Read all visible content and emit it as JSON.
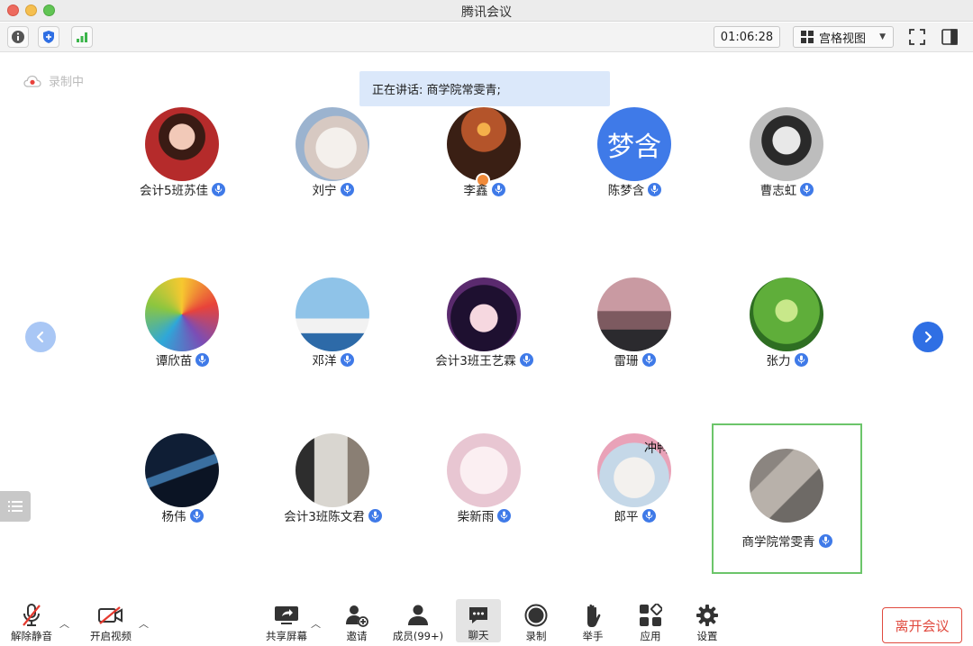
{
  "window": {
    "title": "腾讯会议"
  },
  "toolbar": {
    "timer": "01:06:28",
    "view_mode": "宫格视图"
  },
  "recording": {
    "label": "录制中"
  },
  "speaking": {
    "text": "正在讲话: 商学院常雯青;"
  },
  "participants": [
    {
      "name": "会计5班苏佳",
      "avatar": "photo-girl-red"
    },
    {
      "name": "刘宁",
      "avatar": "photo-cat-bunny"
    },
    {
      "name": "李鑫",
      "avatar": "photo-sunset"
    },
    {
      "name": "陈梦含",
      "avatar": "text-avatar",
      "initials": "梦含"
    },
    {
      "name": "曹志虹",
      "avatar": "photo-woman-bw"
    },
    {
      "name": "谭欣苗",
      "avatar": "photo-colorful-art"
    },
    {
      "name": "邓洋",
      "avatar": "photo-ship"
    },
    {
      "name": "会计3班王艺霖",
      "avatar": "photo-anime-girl"
    },
    {
      "name": "雷珊",
      "avatar": "photo-sky-buildings"
    },
    {
      "name": "张力",
      "avatar": "photo-tree"
    },
    {
      "name": "杨伟",
      "avatar": "photo-night-sky"
    },
    {
      "name": "会计3班陈文君",
      "avatar": "photo-child"
    },
    {
      "name": "柴新雨",
      "avatar": "photo-anime-sketch"
    },
    {
      "name": "郎平",
      "avatar": "photo-cat-flowers",
      "overlay_text": "冲鸭"
    },
    {
      "name": "商学院常雯青",
      "avatar": "photo-wall",
      "active": true
    }
  ],
  "bottombar": {
    "unmute": "解除静音",
    "video": "开启视频",
    "share": "共享屏幕",
    "invite": "邀请",
    "members": "成员(99+)",
    "chat": "聊天",
    "record": "录制",
    "raise_hand": "举手",
    "apps": "应用",
    "settings": "设置",
    "leave": "离开会议"
  },
  "colors": {
    "accent": "#3f7ae8",
    "active_border": "#6cc56a",
    "leave": "#e04a3f",
    "banner": "#dbe8fa"
  }
}
